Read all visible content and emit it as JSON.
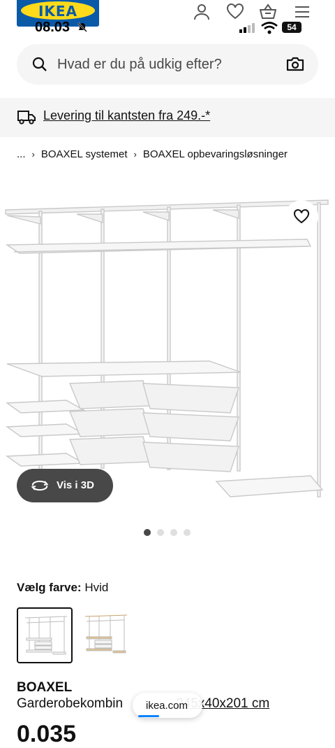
{
  "brand": {
    "logo_text": "IKEA",
    "blue": "#0a5aa8",
    "yellow": "#ffda1a"
  },
  "status_bar": {
    "time": "08.03",
    "battery": "54"
  },
  "header_icons": [
    "user-icon",
    "heart-icon",
    "basket-icon",
    "menu-icon"
  ],
  "search": {
    "placeholder": "Hvad er du på udkig efter?"
  },
  "delivery": {
    "text": "Levering til kantsten fra 249.-*"
  },
  "breadcrumb": {
    "items": [
      "...",
      "BOAXEL systemet",
      "BOAXEL opbevaringsløsninger"
    ]
  },
  "gallery": {
    "view_3d_label": "Vis i 3D",
    "image_count": 4,
    "active_index": 0
  },
  "colour": {
    "label": "Vælg farve:",
    "value": "Hvid",
    "options": [
      "white",
      "oak"
    ]
  },
  "product": {
    "name": "BOAXEL",
    "description": "Garderobekombin",
    "dimensions": "245x40x201 cm",
    "price_partial": "0.035"
  },
  "browser": {
    "url": "ikea.com"
  }
}
